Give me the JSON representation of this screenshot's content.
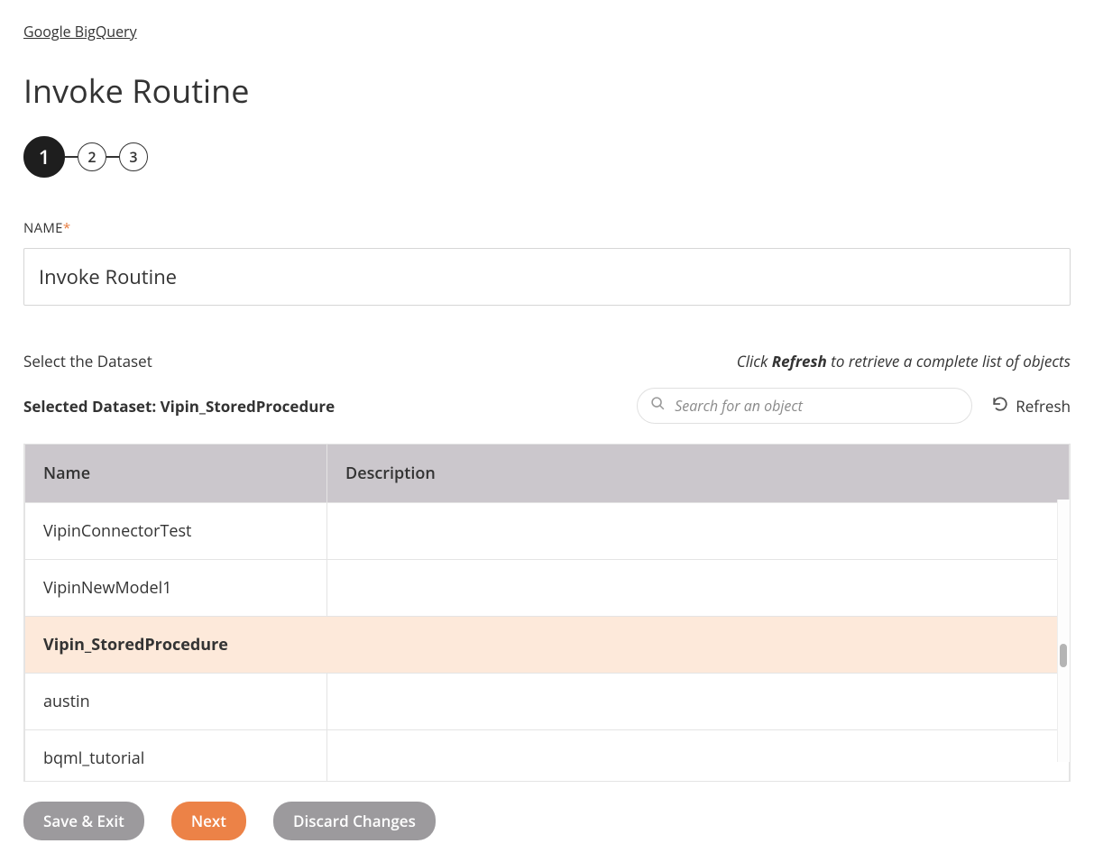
{
  "breadcrumb": "Google BigQuery",
  "page_title": "Invoke Routine",
  "stepper": {
    "steps": [
      "1",
      "2",
      "3"
    ],
    "active_index": 0
  },
  "name_field": {
    "label": "NAME",
    "required_marker": "*",
    "value": "Invoke Routine"
  },
  "dataset_section": {
    "select_label": "Select the Dataset",
    "hint_prefix": "Click ",
    "hint_bold": "Refresh",
    "hint_suffix": " to retrieve a complete list of objects",
    "selected_prefix": "Selected Dataset: ",
    "selected_value": "Vipin_StoredProcedure"
  },
  "search": {
    "placeholder": "Search for an object",
    "value": ""
  },
  "refresh_label": "Refresh",
  "table": {
    "columns": {
      "name": "Name",
      "description": "Description"
    },
    "rows": [
      {
        "name": "VipinConnectorTest",
        "description": "",
        "selected": false
      },
      {
        "name": "VipinNewModel1",
        "description": "",
        "selected": false
      },
      {
        "name": "Vipin_StoredProcedure",
        "description": "",
        "selected": true
      },
      {
        "name": "austin",
        "description": "",
        "selected": false
      },
      {
        "name": "bqml_tutorial",
        "description": "",
        "selected": false
      }
    ]
  },
  "footer": {
    "save_exit": "Save & Exit",
    "next": "Next",
    "discard": "Discard Changes"
  }
}
